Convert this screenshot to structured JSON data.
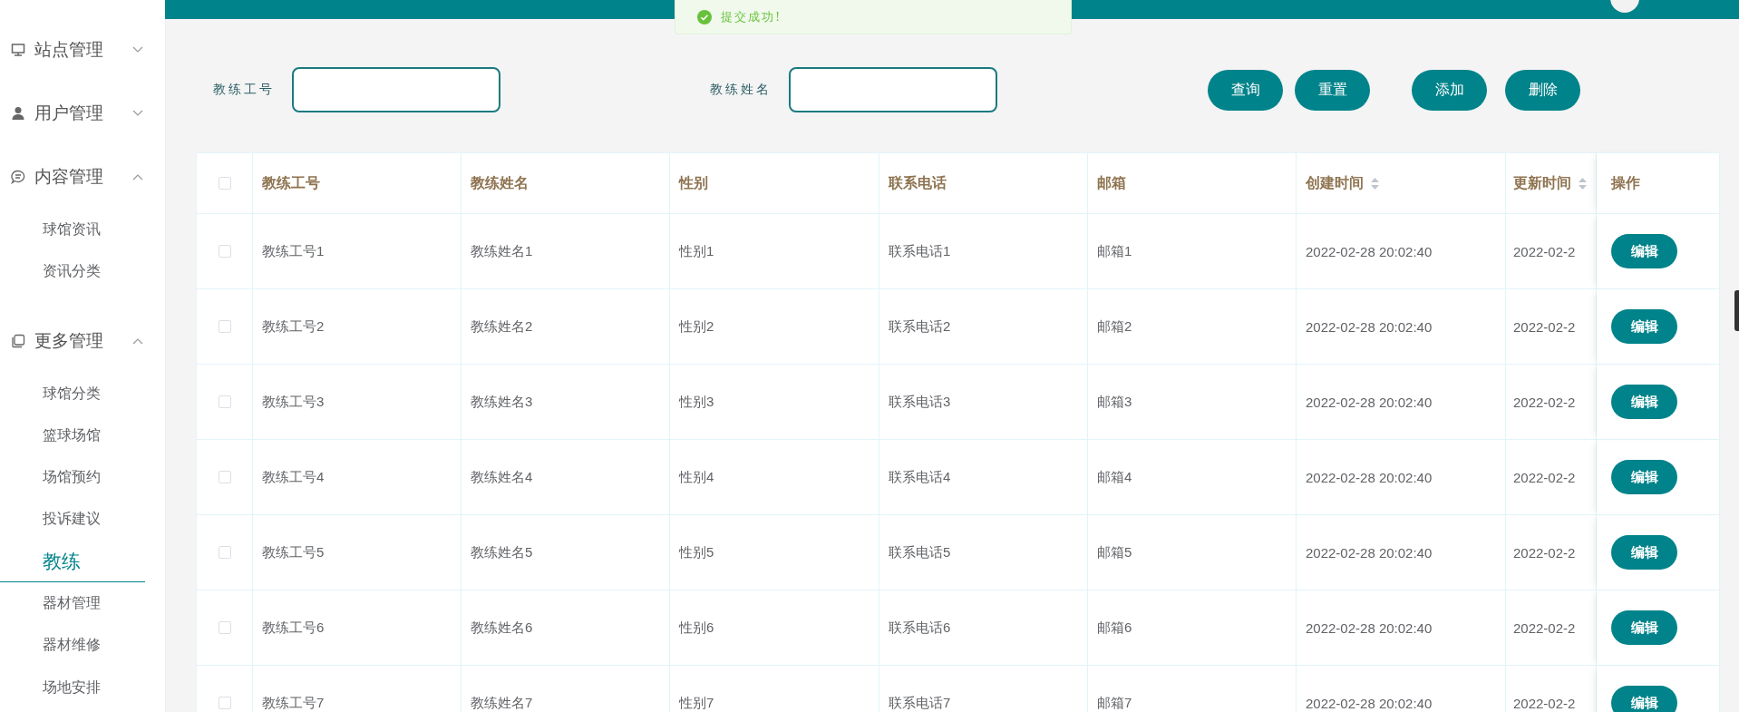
{
  "sidebar": {
    "groups": [
      {
        "label": "站点管理",
        "expanded": false
      },
      {
        "label": "用户管理",
        "expanded": false
      },
      {
        "label": "内容管理",
        "expanded": true,
        "children": [
          {
            "label": "球馆资讯",
            "selected": false
          },
          {
            "label": "资讯分类",
            "selected": false
          }
        ]
      },
      {
        "label": "更多管理",
        "expanded": true,
        "children": [
          {
            "label": "球馆分类",
            "selected": false
          },
          {
            "label": "篮球场馆",
            "selected": false
          },
          {
            "label": "场馆预约",
            "selected": false
          },
          {
            "label": "投诉建议",
            "selected": false
          },
          {
            "label": "教练",
            "selected": true
          },
          {
            "label": "器材管理",
            "selected": false
          },
          {
            "label": "器材维修",
            "selected": false
          },
          {
            "label": "场地安排",
            "selected": false
          }
        ]
      }
    ]
  },
  "toast": {
    "text": "提交成功!"
  },
  "filters": [
    {
      "label": "教练工号"
    },
    {
      "label": "教练姓名"
    }
  ],
  "buttons": [
    "查询",
    "重置",
    "添加",
    "删除"
  ],
  "table": {
    "all_checked": false,
    "columns": [
      {
        "label": "教练工号",
        "sortable": false
      },
      {
        "label": "教练姓名",
        "sortable": false
      },
      {
        "label": "性别",
        "sortable": false
      },
      {
        "label": "联系电话",
        "sortable": false
      },
      {
        "label": "邮箱",
        "sortable": false
      },
      {
        "label": "创建时间",
        "sortable": true
      },
      {
        "label": "更新时间",
        "sortable": true
      },
      {
        "label": "操作",
        "sortable": false
      }
    ],
    "rows": [
      {
        "checked": false,
        "cells": [
          "教练工号1",
          "教练姓名1",
          "性别1",
          "联系电话1",
          "邮箱1",
          "2022-02-28 20:02:40",
          "2022-02-2"
        ],
        "action": "编辑"
      },
      {
        "checked": false,
        "cells": [
          "教练工号2",
          "教练姓名2",
          "性别2",
          "联系电话2",
          "邮箱2",
          "2022-02-28 20:02:40",
          "2022-02-2"
        ],
        "action": "编辑"
      },
      {
        "checked": false,
        "cells": [
          "教练工号3",
          "教练姓名3",
          "性别3",
          "联系电话3",
          "邮箱3",
          "2022-02-28 20:02:40",
          "2022-02-2"
        ],
        "action": "编辑"
      },
      {
        "checked": false,
        "cells": [
          "教练工号4",
          "教练姓名4",
          "性别4",
          "联系电话4",
          "邮箱4",
          "2022-02-28 20:02:40",
          "2022-02-2"
        ],
        "action": "编辑"
      },
      {
        "checked": false,
        "cells": [
          "教练工号5",
          "教练姓名5",
          "性别5",
          "联系电话5",
          "邮箱5",
          "2022-02-28 20:02:40",
          "2022-02-2"
        ],
        "action": "编辑"
      },
      {
        "checked": false,
        "cells": [
          "教练工号6",
          "教练姓名6",
          "性别6",
          "联系电话6",
          "邮箱6",
          "2022-02-28 20:02:40",
          "2022-02-2"
        ],
        "action": "编辑"
      },
      {
        "checked": false,
        "cells": [
          "教练工号7",
          "教练姓名7",
          "性别7",
          "联系电话7",
          "邮箱7",
          "2022-02-28 20:02:40",
          "2022-02-2"
        ],
        "action": "编辑"
      }
    ]
  }
}
